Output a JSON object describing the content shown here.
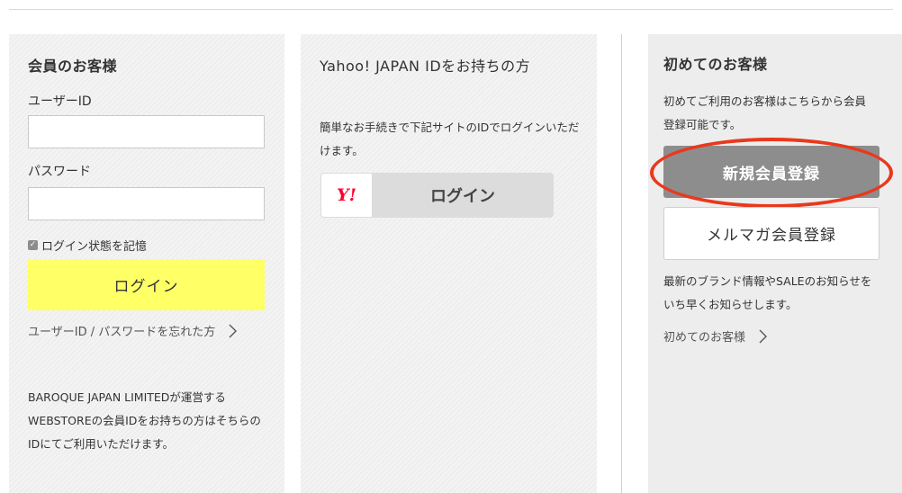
{
  "member": {
    "title": "会員のお客様",
    "username_label": "ユーザーID",
    "username_value": "",
    "password_label": "パスワード",
    "password_value": "",
    "remember_label": "ログイン状態を記憶",
    "login_button": "ログイン",
    "forgot_link": "ユーザーID / パスワードを忘れた方",
    "note": "BAROQUE JAPAN LIMITEDが運営するWEBSTOREの会員IDをお持ちの方はそちらのIDにてご利用いただけます。"
  },
  "yahoo": {
    "title": "Yahoo! JAPAN IDをお持ちの方",
    "description": "簡単なお手続きで下記サイトのIDでログインいただけます。",
    "logo_text": "Y!",
    "login_button": "ログイン"
  },
  "new_customer": {
    "title": "初めてのお客様",
    "description": "初めてご利用のお客様はこちらから会員登録可能です。",
    "register_button": "新規会員登録",
    "newsletter_button": "メルマガ会員登録",
    "newsletter_description": "最新のブランド情報やSALEのお知らせをいち早くお知らせします。",
    "first_time_link": "初めてのお客様"
  },
  "colors": {
    "login_yellow": "#ffff66",
    "register_gray": "#8d8d8d",
    "highlight_red": "#e8391d",
    "yahoo_red": "#ff0033"
  }
}
